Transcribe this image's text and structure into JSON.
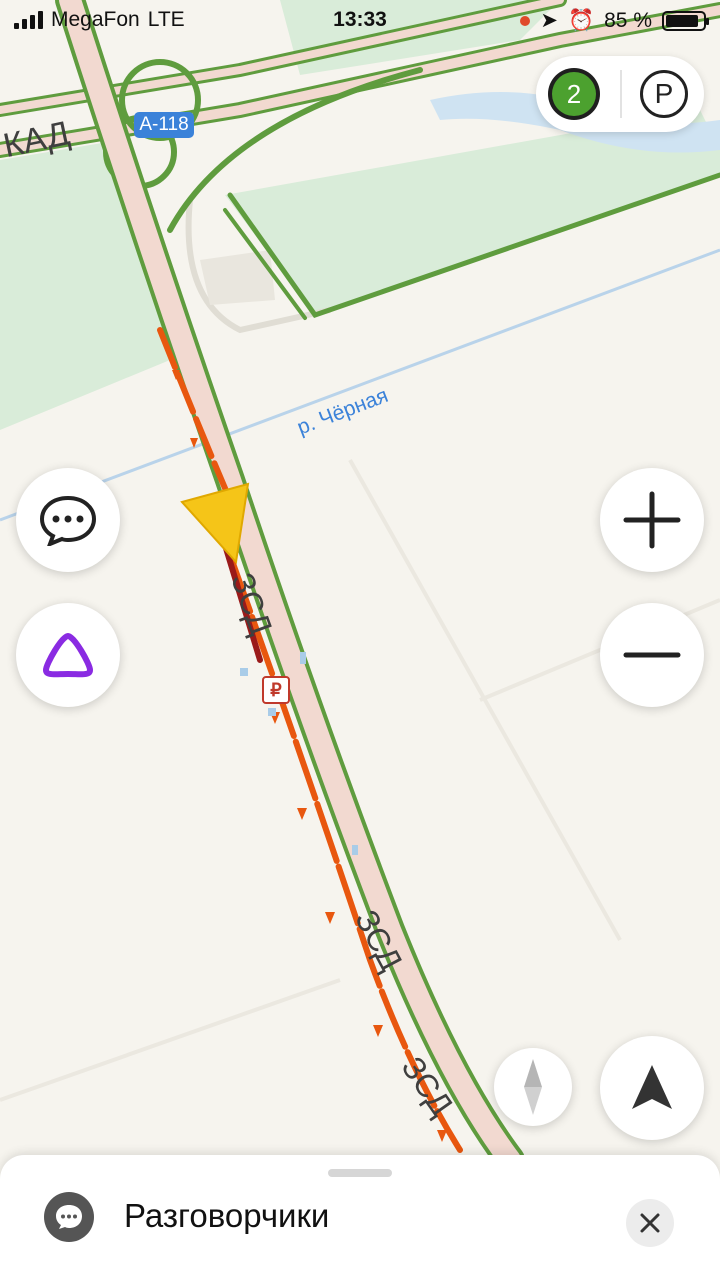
{
  "status_bar": {
    "carrier": "MegaFon",
    "network": "LTE",
    "time": "13:33",
    "battery": "85 %"
  },
  "top_controls": {
    "traffic_level": "2",
    "traffic_color": "#4ca12f",
    "parking_icon": "parking-icon"
  },
  "map": {
    "road_badge": "А-118",
    "ring_label": "КАД",
    "river_label": "р. Чёрная",
    "highway_labels": [
      "ЗСД",
      "ЗСД",
      "ЗСД"
    ],
    "paid_marker": "₽",
    "route_color": "#e8570f",
    "road_color": "#5f9c3e",
    "cursor_color": "#f5c518"
  },
  "side_buttons": {
    "chat": "chat-icon",
    "alice": "alice-icon",
    "zoom_in": "plus-icon",
    "zoom_out": "minus-icon",
    "compass": "compass-icon",
    "navigate": "navigation-arrow-icon"
  },
  "bottom_sheet": {
    "title": "Разговорчики",
    "close": "close-icon"
  }
}
